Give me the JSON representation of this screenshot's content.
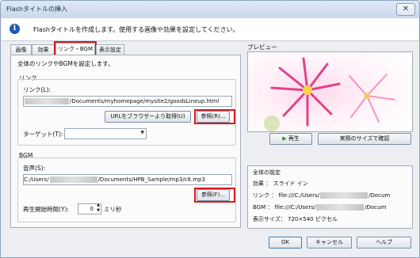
{
  "window": {
    "title": "Flashタイトルの挿入",
    "close_glyph": "✕"
  },
  "info": {
    "text": "Flashタイトルを作成します。使用する画像や効果を設定してください。"
  },
  "tabs": [
    {
      "label": "画像"
    },
    {
      "label": "効果"
    },
    {
      "label": "リンク・BGM",
      "active": true
    },
    {
      "label": "表示設定"
    }
  ],
  "panel": {
    "description": "全体のリンクやBGMを設定します。"
  },
  "link_group": {
    "heading": "リンク",
    "link_label": "リンク(L):",
    "link_value_suffix": "/Documents/myhomepage/mysite2/goodsLineup.html",
    "browser_button": "URLをブラウザーより取得(U)",
    "browse_button": "参照(R)...",
    "target_label": "ターゲット(T):",
    "target_value": ""
  },
  "bgm_group": {
    "heading": "BGM",
    "sound_label": "音声(S):",
    "sound_value_prefix": "C:/Users/",
    "sound_value_suffix": "/Documents/HPB_Sample/mp3/c6.mp3",
    "browse_button": "参照(F)...",
    "start_label": "再生開始時間(Y):",
    "start_value": "0",
    "start_unit": "ミリ秒"
  },
  "preview": {
    "heading": "プレビュー",
    "play_button": "再生",
    "actual_size_button": "実際のサイズで確認"
  },
  "settings": {
    "heading": "全体の設定",
    "effect": "効果 ： スライド イン",
    "link_prefix": "リンク ： file:///C:/Users/",
    "link_suffix": "/Docum",
    "bgm_prefix": "BGM ： file:///C:/Users/",
    "bgm_suffix": "/Docum",
    "size": "表示サイズ： 720×540 ピクセル"
  },
  "footer": {
    "ok": "OK",
    "cancel": "キャンセル",
    "help": "ヘルプ"
  },
  "colors": {
    "accent_red": "#d61c1c",
    "info_blue": "#1f5bb3",
    "play_green": "#2e8b2e"
  }
}
